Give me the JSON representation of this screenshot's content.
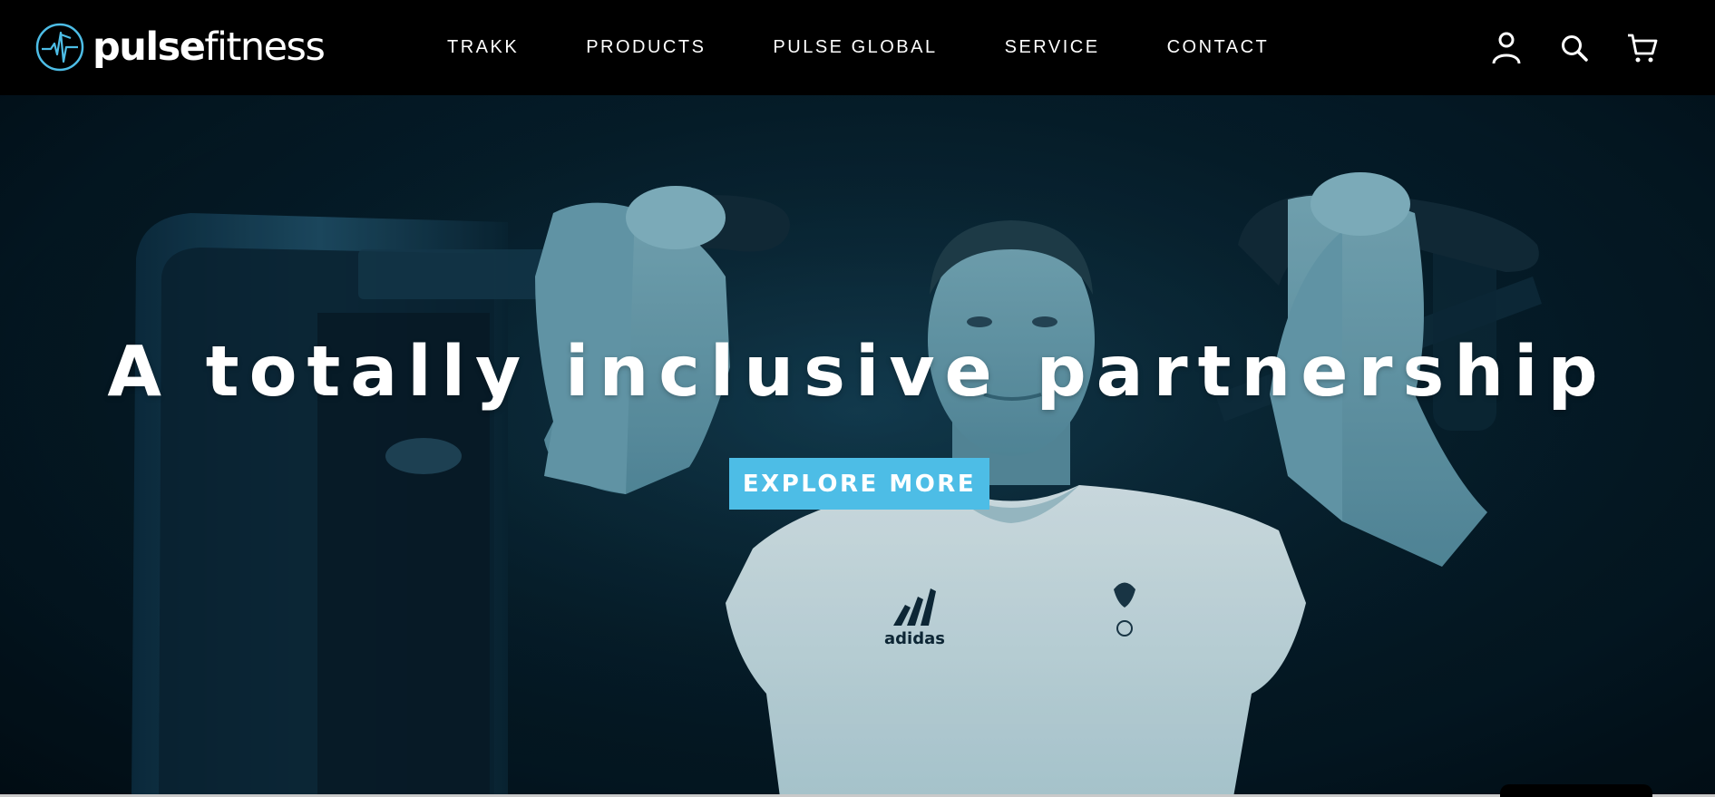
{
  "brand": {
    "name_bold": "pulse",
    "name_light": "fitness",
    "accent_color": "#4dbde6"
  },
  "nav": {
    "items": [
      {
        "label": "TRAKK"
      },
      {
        "label": "PRODUCTS"
      },
      {
        "label": "PULSE GLOBAL"
      },
      {
        "label": "SERVICE"
      },
      {
        "label": "CONTACT"
      }
    ]
  },
  "header_icons": [
    "account-icon",
    "search-icon",
    "cart-icon"
  ],
  "hero": {
    "title": "A totally inclusive partnership",
    "cta_label": "EXPLORE MORE",
    "shirt_brand": "adidas"
  }
}
